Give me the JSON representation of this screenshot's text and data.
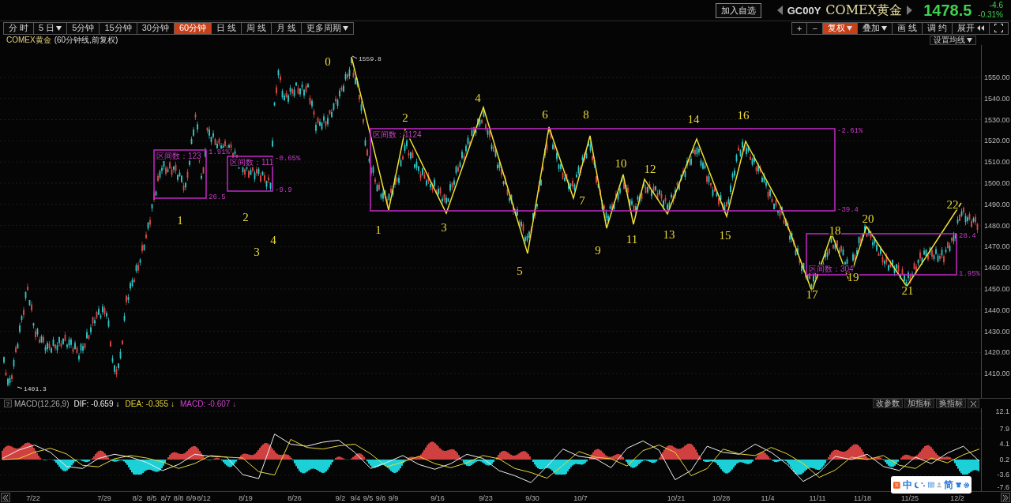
{
  "quote_header": {
    "watch_button": "加入自选",
    "symbol_code": "GC00Y",
    "symbol_name": "COMEX黄金",
    "price": "1478.5",
    "change": "-4.6",
    "change_percent": "-0.31%"
  },
  "period_tabs": [
    {
      "label": "分 时",
      "selected": false,
      "has_menu": false
    },
    {
      "label": "5 日",
      "selected": false,
      "has_menu": true
    },
    {
      "label": "5分钟",
      "selected": false,
      "has_menu": false
    },
    {
      "label": "15分钟",
      "selected": false,
      "has_menu": false
    },
    {
      "label": "30分钟",
      "selected": false,
      "has_menu": false
    },
    {
      "label": "60分钟",
      "selected": true,
      "has_menu": false
    },
    {
      "label": "日 线",
      "selected": false,
      "has_menu": false
    },
    {
      "label": "周 线",
      "selected": false,
      "has_menu": false
    },
    {
      "label": "月 线",
      "selected": false,
      "has_menu": false
    },
    {
      "label": "更多周期",
      "selected": false,
      "has_menu": true
    }
  ],
  "chart_tools": [
    {
      "kind": "text",
      "label": "+",
      "selected": false,
      "has_menu": false
    },
    {
      "kind": "text",
      "label": "−",
      "selected": false,
      "has_menu": false
    },
    {
      "kind": "text",
      "label": "复权",
      "selected": true,
      "has_menu": true
    },
    {
      "kind": "text",
      "label": "叠加",
      "selected": false,
      "has_menu": true
    },
    {
      "kind": "text",
      "label": "画 线",
      "selected": false,
      "has_menu": false
    },
    {
      "kind": "text",
      "label": "调 约",
      "selected": false,
      "has_menu": false
    },
    {
      "kind": "expand",
      "label": "展开",
      "selected": false
    },
    {
      "kind": "fullscreen",
      "selected": false
    }
  ],
  "price_chart": {
    "title": "COMEX黄金",
    "subtitle": "(60分钟线,前复权)",
    "ma_button": "设置均线",
    "y_ticks": [
      "1550.00",
      "1540.00",
      "1530.00",
      "1520.00",
      "1510.00",
      "1500.00",
      "1490.00",
      "1480.00",
      "1470.00",
      "1460.00",
      "1450.00",
      "1440.00",
      "1430.00",
      "1420.00",
      "1410.00"
    ],
    "high_label": "1559.8",
    "low_label": "1401.3",
    "wave_labels": [
      "1",
      "2",
      "3",
      "4",
      "0",
      "1",
      "2",
      "3",
      "4",
      "5",
      "6",
      "7",
      "8",
      "9",
      "10",
      "11",
      "12",
      "13",
      "14",
      "15",
      "16",
      "17",
      "18",
      "19",
      "20",
      "21",
      "22"
    ],
    "ranges": [
      {
        "label": "区间数：123",
        "upper_value": "1.91%",
        "lower_value": "26.5"
      },
      {
        "label": "区间数：111",
        "upper_value": "-0.65%",
        "lower_value": "-9.9"
      },
      {
        "label": "区间数：1124",
        "upper_value": "-2.61%",
        "lower_value": "-39.4"
      },
      {
        "label": "区间数：304",
        "upper_value": "28.4",
        "lower_value": "1.95%"
      }
    ]
  },
  "macd_panel": {
    "help_button": "?",
    "indicator": "MACD(12,26,9)",
    "values": [
      {
        "separator": ":",
        "value": "-0.659",
        "arrow": "↓"
      },
      {
        "separator": ":",
        "value": "-0.355",
        "arrow": "↓"
      },
      {
        "name": "MACD",
        "separator": ":",
        "value": "-0.607",
        "color": "#d040d0",
        "arrow": "↓"
      }
    ],
    "buttons": [
      "改参数",
      "加指标",
      "换指标"
    ],
    "chart_data": {
      "type": "line",
      "grid": true,
      "ylim": [
        -7.6,
        12.1
      ],
      "yticks": [
        {
          "value": 12.1,
          "label": "12.1"
        },
        {
          "value": 7.9,
          "label": "7.9"
        },
        {
          "value": 4.1,
          "label": "4.1"
        },
        {
          "value": 0.2,
          "label": "0.2"
        },
        {
          "value": -3.6,
          "label": "-3.6"
        },
        {
          "value": -7.6,
          "label": "-7.6"
        }
      ],
      "series": [
        {
          "name": "DIF",
          "color": "#f0f0f0",
          "values": [
            0.5,
            2.5,
            3.8,
            2.0,
            -1.5,
            -2.0,
            0.5,
            1.5,
            0.8,
            -0.5,
            -2.5,
            -1.0,
            1.5,
            1.0,
            0.8,
            -3.5,
            -4.5,
            6.5,
            4.0,
            3.5,
            4.5,
            5.0,
            2.0,
            -2.0,
            -0.5,
            1.2,
            -1.0,
            -2.2,
            -0.8,
            1.5,
            0.5,
            -2.5,
            -3.8,
            -5.5,
            -1.5,
            2.8,
            1.0,
            0.5,
            -1.8,
            3.0,
            4.8,
            2.5,
            -4.8,
            -2.5,
            3.5,
            2.0,
            1.5,
            4.0,
            2.0,
            -1.0,
            -5.2,
            -3.0,
            1.0,
            0.2,
            1.5,
            -1.5,
            -2.5,
            0.8,
            -0.8,
            1.8,
            3.5,
            -0.2
          ]
        },
        {
          "name": "DEA",
          "color": "#e8d838",
          "values": [
            0.2,
            0.4,
            2.0,
            3.0,
            1.6,
            -1.2,
            -1.6,
            0.4,
            1.2,
            0.6,
            -0.4,
            -2.0,
            -0.8,
            1.2,
            0.8,
            0.6,
            -2.8,
            -3.6,
            5.2,
            3.2,
            2.8,
            3.6,
            4.0,
            1.6,
            -1.6,
            -0.4,
            1.0,
            -0.8,
            -1.8,
            -0.6,
            1.2,
            0.4,
            -2.0,
            -3.0,
            -4.4,
            -1.2,
            2.2,
            0.8,
            0.4,
            -1.4,
            2.4,
            3.8,
            2.0,
            -3.8,
            -2.0,
            2.8,
            1.6,
            1.2,
            3.2,
            1.6,
            -0.8,
            -4.2,
            -2.4,
            0.8,
            0.2,
            1.2,
            -1.2,
            -2.0,
            0.6,
            -0.6,
            1.4,
            2.8
          ]
        }
      ]
    }
  },
  "date_axis": [
    "7/22",
    "7/29",
    "8/2",
    "8/5",
    "8/7",
    "8/8",
    "8/9",
    "8/12",
    "8/19",
    "8/26",
    "9/2",
    "9/4",
    "9/5",
    "9/6",
    "9/9",
    "9/16",
    "9/23",
    "9/30",
    "10/7",
    "10/21",
    "10/28",
    "11/4",
    "11/11",
    "11/18",
    "11/25",
    "12/2"
  ],
  "ime_toolbar": {
    "mode": "中",
    "script": "简"
  }
}
